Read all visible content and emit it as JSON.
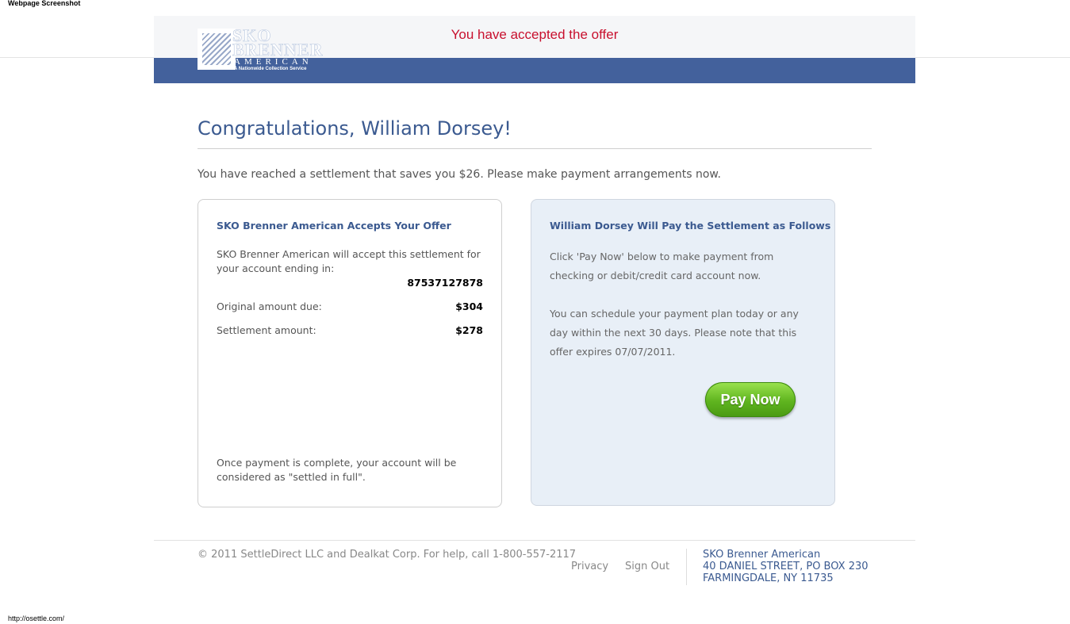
{
  "screenshot_label": "Webpage Screenshot",
  "url_label": "http://osettle.com/",
  "header": {
    "notice": "You have accepted the offer",
    "logo": {
      "line1": "SKO",
      "line2": "BRENNER",
      "line3": "AMERICAN",
      "tagline": "A Nationwide Collection Service"
    },
    "colors": {
      "band": "#43619c",
      "notice": "#c8102e"
    }
  },
  "main": {
    "title": "Congratulations, William Dorsey!",
    "subtitle": "You have reached a settlement that saves you $26. Please make payment arrangements now."
  },
  "offer_box": {
    "heading": "SKO Brenner American Accepts Your Offer",
    "intro": "SKO Brenner American will accept this settlement for your account ending in:",
    "account_number": "87537127878",
    "original_label": "Original amount due:",
    "original_value": "$304",
    "settlement_label": "Settlement amount:",
    "settlement_value": "$278",
    "footer_note": "Once payment is complete, your account will be considered as \"settled in full\"."
  },
  "payment_box": {
    "heading": "William Dorsey Will Pay the Settlement as Follows",
    "para1": "Click 'Pay Now' below to make payment from checking or debit/credit card account now.",
    "para2": "You can schedule your payment plan today or any day within the next 30 days. Please note that this offer expires 07/07/2011.",
    "button_label": "Pay Now"
  },
  "footer": {
    "copyright": "© 2011 SettleDirect LLC and Dealkat Corp. For help, call 1-800-557-2117",
    "links": {
      "privacy": "Privacy",
      "sign_out": "Sign Out"
    },
    "address": {
      "name": "SKO Brenner American",
      "street": "40 DANIEL STREET, PO BOX 230",
      "city": "FARMINGDALE, NY 11735"
    }
  }
}
